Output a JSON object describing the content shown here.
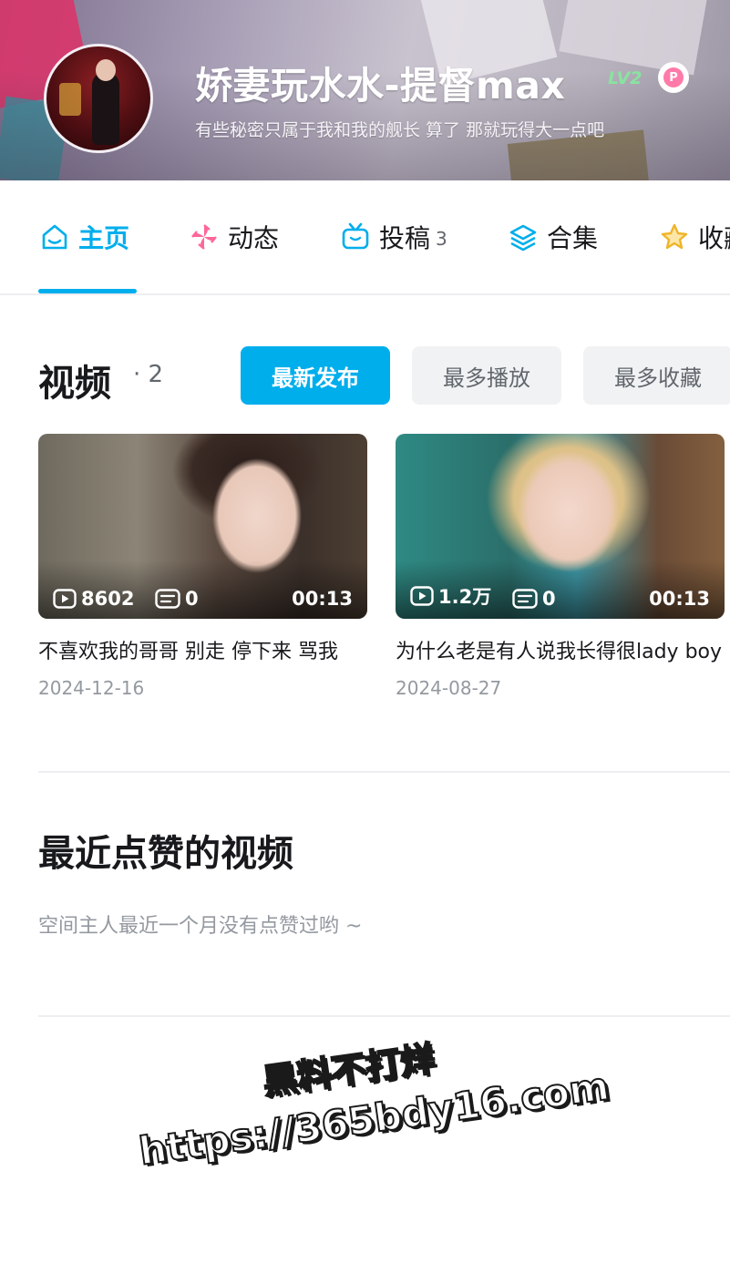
{
  "header": {
    "username": "娇妻玩水水-提督max",
    "level": "LV2",
    "bio": "有些秘密只属于我和我的舰长 算了 那就玩得大一点吧",
    "avatar_icon": "user-avatar"
  },
  "tabs": [
    {
      "label": "主页",
      "icon": "home-icon",
      "active": true
    },
    {
      "label": "动态",
      "icon": "pinwheel-icon",
      "active": false
    },
    {
      "label": "投稿",
      "count": "3",
      "icon": "tv-icon",
      "active": false
    },
    {
      "label": "合集",
      "icon": "layers-icon",
      "active": false
    },
    {
      "label": "收藏",
      "icon": "star-icon",
      "active": false
    }
  ],
  "videos_section": {
    "title": "视频",
    "count": "· 2",
    "sort_options": [
      {
        "label": "最新发布",
        "active": true
      },
      {
        "label": "最多播放",
        "active": false
      },
      {
        "label": "最多收藏",
        "active": false
      }
    ],
    "videos": [
      {
        "plays": "8602",
        "danmaku": "0",
        "duration": "00:13",
        "title": "不喜欢我的哥哥 别走 停下来 骂我",
        "date": "2024-12-16"
      },
      {
        "plays": "1.2万",
        "danmaku": "0",
        "duration": "00:13",
        "title": "为什么老是有人说我长得很lady boy",
        "date": "2024-08-27"
      }
    ]
  },
  "liked_section": {
    "title": "最近点赞的视频",
    "empty_text": "空间主人最近一个月没有点赞过哟 ~"
  },
  "watermark": {
    "line1": "黑料不打烊",
    "line2": "https://365bdy16.com"
  },
  "colors": {
    "accent": "#00aeec",
    "text_primary": "#18191c",
    "text_secondary": "#9499a0",
    "level_badge": "#89e3a0"
  }
}
